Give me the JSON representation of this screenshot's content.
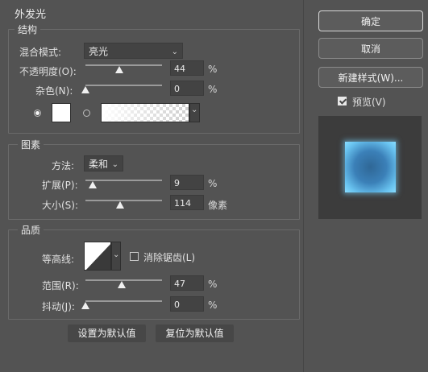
{
  "dialog": {
    "title": "外发光"
  },
  "structure": {
    "legend": "结构",
    "blend_mode_label": "混合模式:",
    "blend_mode_value": "亮光",
    "opacity_label": "不透明度(O):",
    "opacity_value": "44",
    "opacity_unit": "%",
    "opacity_fraction": 0.44,
    "noise_label": "杂色(N):",
    "noise_value": "0",
    "noise_unit": "%",
    "noise_fraction": 0.0,
    "color_mode": "solid-color"
  },
  "elements": {
    "legend": "图素",
    "technique_label": "方法:",
    "technique_value": "柔和",
    "spread_label": "扩展(P):",
    "spread_value": "9",
    "spread_unit": "%",
    "spread_fraction": 0.09,
    "size_label": "大小(S):",
    "size_value": "114",
    "size_unit": "像素",
    "size_fraction": 0.456
  },
  "quality": {
    "legend": "品质",
    "contour_label": "等高线:",
    "antialias_label": "消除锯齿(L)",
    "antialias_checked": false,
    "range_label": "范围(R):",
    "range_value": "47",
    "range_unit": "%",
    "range_fraction": 0.47,
    "jitter_label": "抖动(J):",
    "jitter_value": "0",
    "jitter_unit": "%",
    "jitter_fraction": 0.0
  },
  "footer": {
    "set_default_label": "设置为默认值",
    "reset_default_label": "复位为默认值"
  },
  "side": {
    "ok_label": "确定",
    "cancel_label": "取消",
    "new_style_label": "新建样式(W)...",
    "preview_label": "预览(V)",
    "preview_checked": true
  },
  "colors": {
    "background": "#535353",
    "glow_color": "#ffffff",
    "preview_fill": "#3d7fb5",
    "preview_glow": "#7fd3ff"
  }
}
